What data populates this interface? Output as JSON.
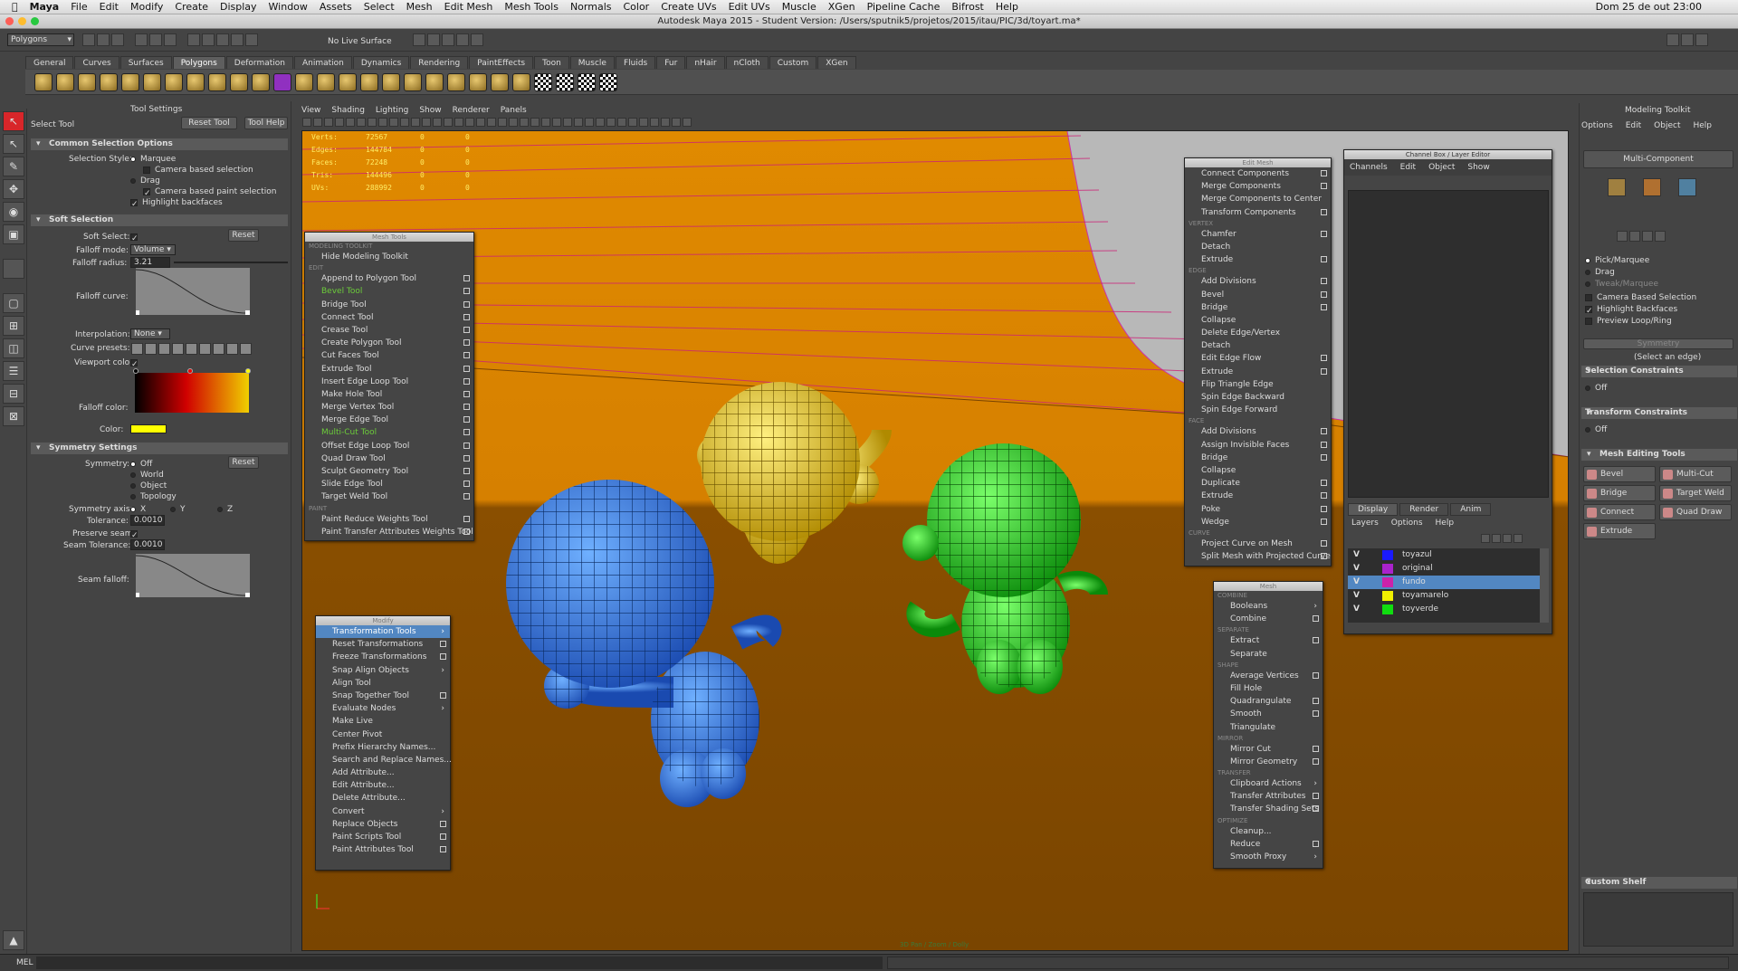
{
  "menubar": {
    "app": "Maya",
    "items": [
      "File",
      "Edit",
      "Modify",
      "Create",
      "Display",
      "Window",
      "Assets",
      "Select",
      "Mesh",
      "Edit Mesh",
      "Mesh Tools",
      "Normals",
      "Color",
      "Create UVs",
      "Edit UVs",
      "Muscle",
      "XGen",
      "Pipeline Cache",
      "Bifrost",
      "Help"
    ],
    "clock": "Dom 25 de out  23:00"
  },
  "window_title": "Autodesk Maya 2015 - Student Version: /Users/sputnik5/projetos/2015/itau/PIC/3d/toyart.ma*",
  "status": {
    "mode": "Polygons",
    "live": "No Live Surface"
  },
  "shelf_tabs": [
    "General",
    "Curves",
    "Surfaces",
    "Polygons",
    "Deformation",
    "Animation",
    "Dynamics",
    "Rendering",
    "PaintEffects",
    "Toon",
    "Muscle",
    "Fluids",
    "Fur",
    "nHair",
    "nCloth",
    "Custom",
    "XGen"
  ],
  "tool_settings": {
    "header": "Tool Settings",
    "tool": "Select Tool",
    "reset": "Reset Tool",
    "help": "Tool Help",
    "common": "Common Selection Options",
    "sel_style": "Selection Style:",
    "marquee": "Marquee",
    "camera_based": "Camera based selection",
    "drag": "Drag",
    "camera_paint": "Camera based paint selection",
    "highlight": "Highlight backfaces",
    "soft": "Soft Selection",
    "soft_select": "Soft Select:",
    "reset_btn": "Reset",
    "falloff_mode": "Falloff mode:",
    "falloff_mode_val": "Volume",
    "falloff_radius": "Falloff radius:",
    "falloff_radius_val": "3.21",
    "falloff_curve": "Falloff curve:",
    "interp": "Interpolation:",
    "interp_val": "None",
    "presets": "Curve presets:",
    "vp_color": "Viewport color:",
    "falloff_color": "Falloff color:",
    "color": "Color:",
    "sym": "Symmetry Settings",
    "symmetry": "Symmetry:",
    "off": "Off",
    "world": "World",
    "object": "Object",
    "topology": "Topology",
    "sym_axis": "Symmetry axis:",
    "x": "X",
    "y": "Y",
    "z": "Z",
    "tolerance": "Tolerance:",
    "tolerance_val": "0.0010",
    "preserve": "Preserve seam:",
    "seam_tol": "Seam Tolerance:",
    "seam_tol_val": "0.0010",
    "seam_falloff": "Seam falloff:"
  },
  "panel_menu": [
    "View",
    "Shading",
    "Lighting",
    "Show",
    "Renderer",
    "Panels"
  ],
  "hud": [
    {
      "label": "Verts:",
      "v": [
        "72567",
        "0",
        "0"
      ]
    },
    {
      "label": "Edges:",
      "v": [
        "144784",
        "0",
        "0"
      ]
    },
    {
      "label": "Faces:",
      "v": [
        "72248",
        "0",
        "0"
      ]
    },
    {
      "label": "Tris:",
      "v": [
        "144496",
        "0",
        "0"
      ]
    },
    {
      "label": "UVs:",
      "v": [
        "288992",
        "0",
        "0"
      ]
    }
  ],
  "viewport_footer": "3D Pan / Zoom / Dolly",
  "mesh_tools": {
    "title": "Mesh Tools",
    "items": [
      {
        "t": "MODELING TOOLKIT",
        "h": 1
      },
      {
        "t": "Hide Modeling Toolkit"
      },
      {
        "t": "EDIT",
        "h": 1
      },
      {
        "t": "Append to Polygon Tool",
        "o": 1
      },
      {
        "t": "Bevel Tool",
        "o": 1,
        "g": 1
      },
      {
        "t": "Bridge Tool",
        "o": 1
      },
      {
        "t": "Connect Tool",
        "o": 1
      },
      {
        "t": "Crease Tool",
        "o": 1
      },
      {
        "t": "Create Polygon Tool",
        "o": 1
      },
      {
        "t": "Cut Faces Tool",
        "o": 1
      },
      {
        "t": "Extrude Tool",
        "o": 1
      },
      {
        "t": "Insert Edge Loop Tool",
        "o": 1
      },
      {
        "t": "Make Hole Tool",
        "o": 1
      },
      {
        "t": "Merge Vertex Tool",
        "o": 1
      },
      {
        "t": "Merge Edge Tool",
        "o": 1
      },
      {
        "t": "Multi-Cut Tool",
        "o": 1,
        "g": 1
      },
      {
        "t": "Offset Edge Loop Tool",
        "o": 1
      },
      {
        "t": "Quad Draw Tool",
        "o": 1
      },
      {
        "t": "Sculpt Geometry Tool",
        "o": 1
      },
      {
        "t": "Slide Edge Tool",
        "o": 1
      },
      {
        "t": "Target Weld Tool",
        "o": 1
      },
      {
        "t": "PAINT",
        "h": 1
      },
      {
        "t": "Paint Reduce Weights Tool",
        "o": 1
      },
      {
        "t": "Paint Transfer Attributes Weights Tool",
        "o": 1
      }
    ]
  },
  "modify": {
    "title": "Modify",
    "items": [
      {
        "t": "Transformation Tools",
        "a": 1,
        "s": 1
      },
      {
        "t": "Reset Transformations",
        "o": 1
      },
      {
        "t": "Freeze Transformations",
        "o": 1
      },
      {
        "t": "Snap Align Objects",
        "a": 1
      },
      {
        "t": "Align Tool"
      },
      {
        "t": "Snap Together Tool",
        "o": 1
      },
      {
        "t": "Evaluate Nodes",
        "a": 1
      },
      {
        "t": "Make Live"
      },
      {
        "t": "Center Pivot"
      },
      {
        "t": "Prefix Hierarchy Names..."
      },
      {
        "t": "Search and Replace Names..."
      },
      {
        "t": "Add Attribute..."
      },
      {
        "t": "Edit Attribute..."
      },
      {
        "t": "Delete Attribute..."
      },
      {
        "t": "Convert",
        "a": 1
      },
      {
        "t": "Replace Objects",
        "o": 1
      },
      {
        "t": "Paint Scripts Tool",
        "o": 1
      },
      {
        "t": "Paint Attributes Tool",
        "o": 1
      }
    ]
  },
  "edit_mesh": {
    "title": "Edit Mesh",
    "items": [
      {
        "t": "Connect Components",
        "o": 1
      },
      {
        "t": "Merge Components",
        "o": 1
      },
      {
        "t": "Merge Components to Center"
      },
      {
        "t": "Transform Components",
        "o": 1
      },
      {
        "t": "VERTEX",
        "h": 1
      },
      {
        "t": "Chamfer",
        "o": 1
      },
      {
        "t": "Detach"
      },
      {
        "t": "Extrude",
        "o": 1
      },
      {
        "t": "EDGE",
        "h": 1
      },
      {
        "t": "Add Divisions",
        "o": 1
      },
      {
        "t": "Bevel",
        "o": 1
      },
      {
        "t": "Bridge",
        "o": 1
      },
      {
        "t": "Collapse"
      },
      {
        "t": "Delete Edge/Vertex"
      },
      {
        "t": "Detach"
      },
      {
        "t": "Edit Edge Flow",
        "o": 1
      },
      {
        "t": "Extrude",
        "o": 1
      },
      {
        "t": "Flip Triangle Edge"
      },
      {
        "t": "Spin Edge Backward"
      },
      {
        "t": "Spin Edge Forward"
      },
      {
        "t": "FACE",
        "h": 1
      },
      {
        "t": "Add Divisions",
        "o": 1
      },
      {
        "t": "Assign Invisible Faces",
        "o": 1
      },
      {
        "t": "Bridge",
        "o": 1
      },
      {
        "t": "Collapse"
      },
      {
        "t": "Duplicate",
        "o": 1
      },
      {
        "t": "Extrude",
        "o": 1
      },
      {
        "t": "Poke",
        "o": 1
      },
      {
        "t": "Wedge",
        "o": 1
      },
      {
        "t": "CURVE",
        "h": 1
      },
      {
        "t": "Project Curve on Mesh",
        "o": 1
      },
      {
        "t": "Split Mesh with Projected Curve",
        "o": 1
      }
    ]
  },
  "mesh": {
    "title": "Mesh",
    "items": [
      {
        "t": "COMBINE",
        "h": 1
      },
      {
        "t": "Booleans",
        "a": 1
      },
      {
        "t": "Combine",
        "o": 1
      },
      {
        "t": "SEPARATE",
        "h": 1
      },
      {
        "t": "Extract",
        "o": 1
      },
      {
        "t": "Separate"
      },
      {
        "t": "SHAPE",
        "h": 1
      },
      {
        "t": "Average Vertices",
        "o": 1
      },
      {
        "t": "Fill Hole"
      },
      {
        "t": "Quadrangulate",
        "o": 1
      },
      {
        "t": "Smooth",
        "o": 1
      },
      {
        "t": "Triangulate"
      },
      {
        "t": "MIRROR",
        "h": 1
      },
      {
        "t": "Mirror Cut",
        "o": 1
      },
      {
        "t": "Mirror Geometry",
        "o": 1
      },
      {
        "t": "TRANSFER",
        "h": 1
      },
      {
        "t": "Clipboard Actions",
        "a": 1
      },
      {
        "t": "Transfer Attributes",
        "o": 1
      },
      {
        "t": "Transfer Shading Sets",
        "o": 1
      },
      {
        "t": "OPTIMIZE",
        "h": 1
      },
      {
        "t": "Cleanup..."
      },
      {
        "t": "Reduce",
        "o": 1
      },
      {
        "t": "Smooth Proxy",
        "a": 1
      }
    ]
  },
  "channel_box": {
    "title": "Channel Box / Layer Editor",
    "menu": [
      "Channels",
      "Edit",
      "Object",
      "Show"
    ],
    "tabs": [
      "Display",
      "Render",
      "Anim"
    ],
    "layer_menu": [
      "Layers",
      "Options",
      "Help"
    ],
    "layers": [
      {
        "name": "toyazul",
        "color": "#1a1aff"
      },
      {
        "name": "original",
        "color": "#aa22cc"
      },
      {
        "name": "fundo",
        "color": "#cc22aa",
        "sel": 1
      },
      {
        "name": "toyamarelo",
        "color": "#f0f000"
      },
      {
        "name": "toyverde",
        "color": "#10dd10"
      }
    ]
  },
  "toolkit": {
    "title": "Modeling Toolkit",
    "menu": [
      "Options",
      "Edit",
      "Object",
      "Help"
    ],
    "mode": "Multi-Component",
    "pick": "Pick/Marquee",
    "drag": "Drag",
    "tweak": "Tweak/Marquee",
    "cam": "Camera Based Selection",
    "hb": "Highlight Backfaces",
    "pl": "Preview Loop/Ring",
    "sym": "Symmetry",
    "sel_edge": "(Select an edge)",
    "sc": "Selection Constraints",
    "off1": "Off",
    "tc": "Transform Constraints",
    "off2": "Off",
    "met": "Mesh Editing Tools",
    "tools": [
      "Bevel",
      "Multi-Cut",
      "Bridge",
      "Target Weld",
      "Connect",
      "Quad Draw",
      "Extrude"
    ],
    "custom": "Custom Shelf"
  },
  "cmdline": "MEL"
}
